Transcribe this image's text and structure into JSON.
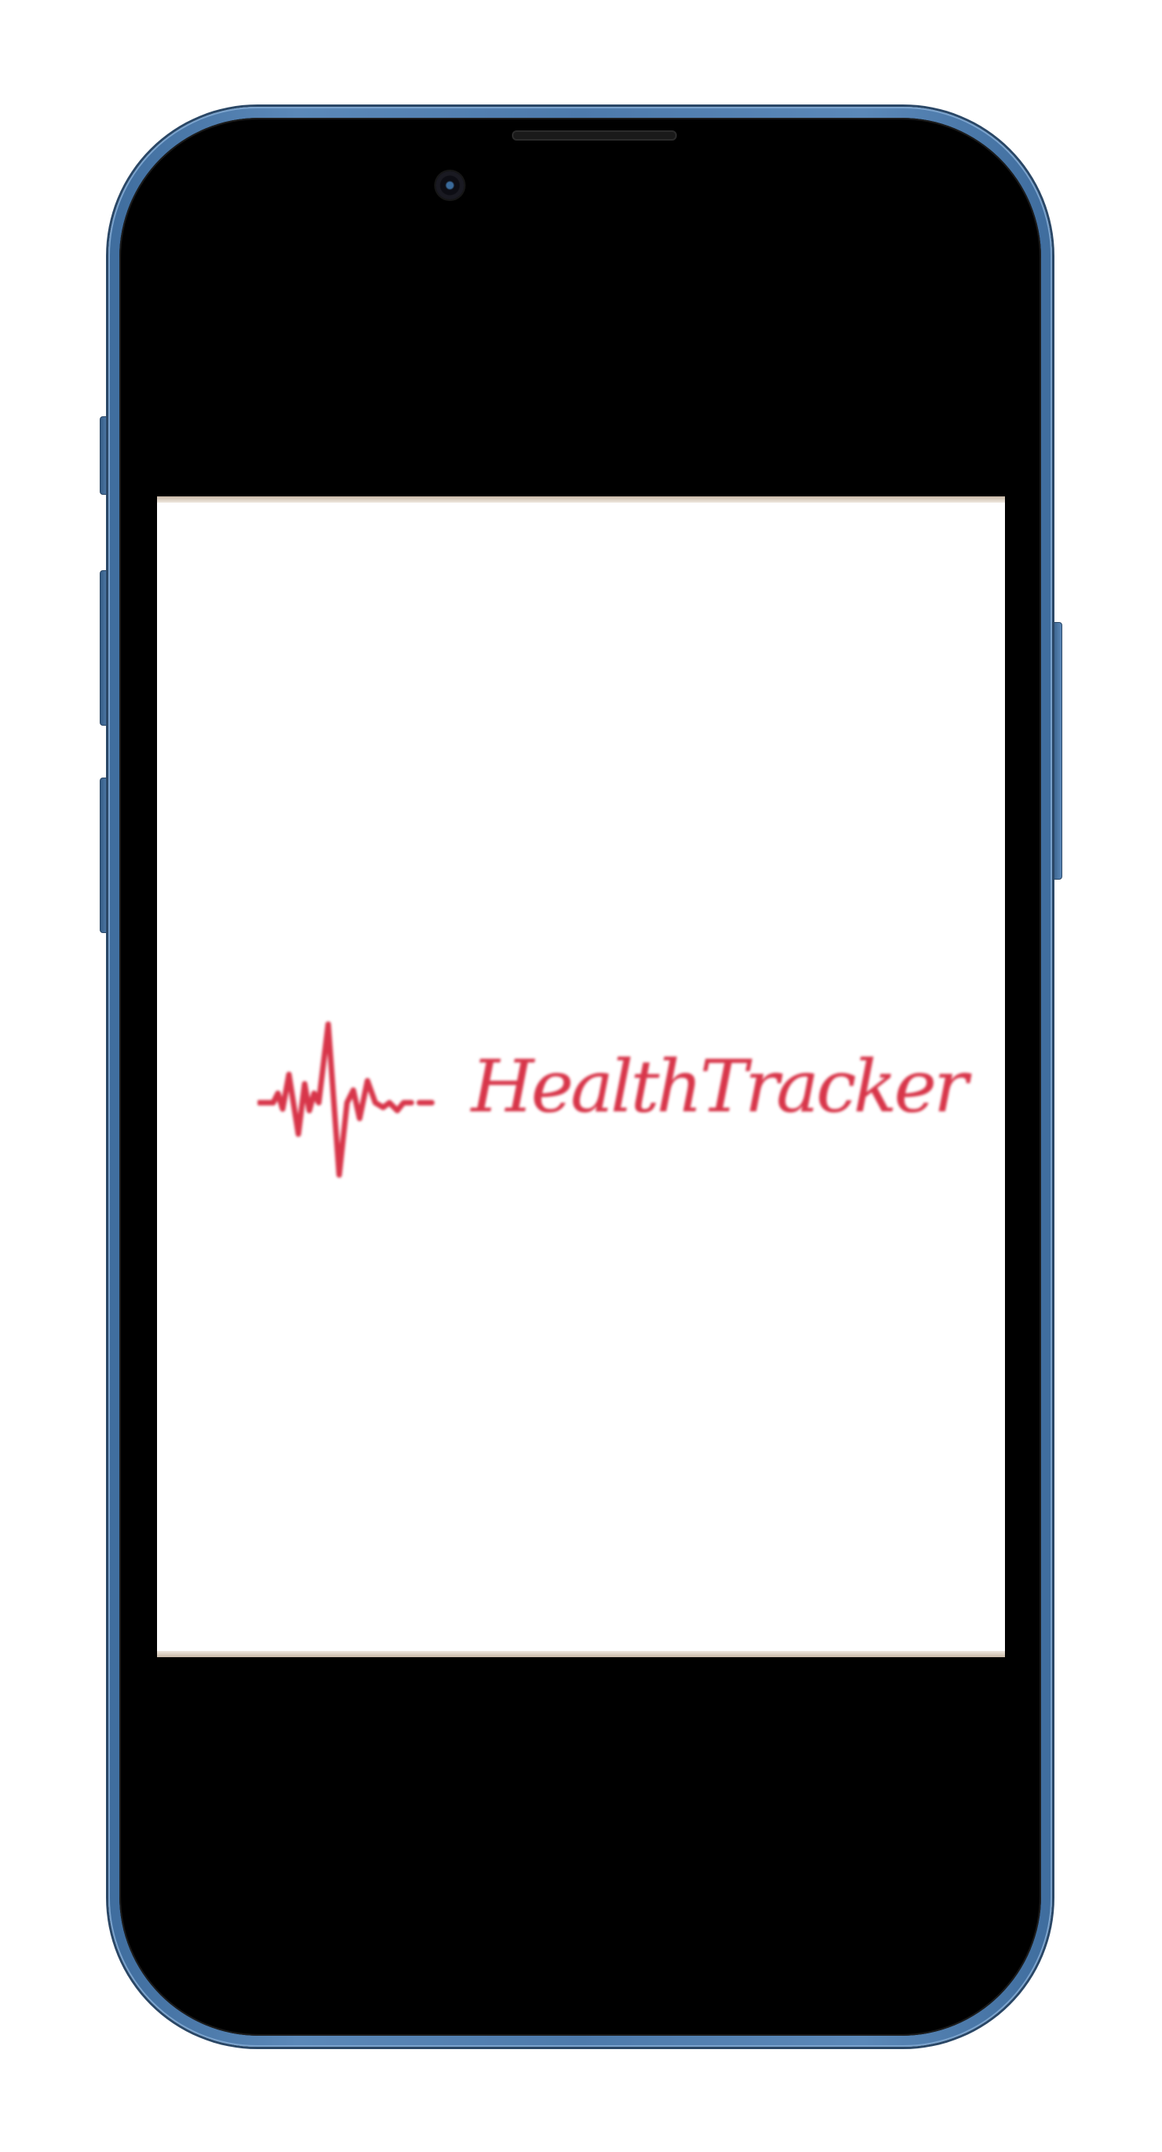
{
  "app": {
    "logo_text": "HealthTracker",
    "brand_color": "#d8364a"
  },
  "device": {
    "frame_color": "#4d7aab",
    "bezel_color": "#000000"
  },
  "icons": {
    "logo_mark": "heartbeat-pulse-icon"
  }
}
